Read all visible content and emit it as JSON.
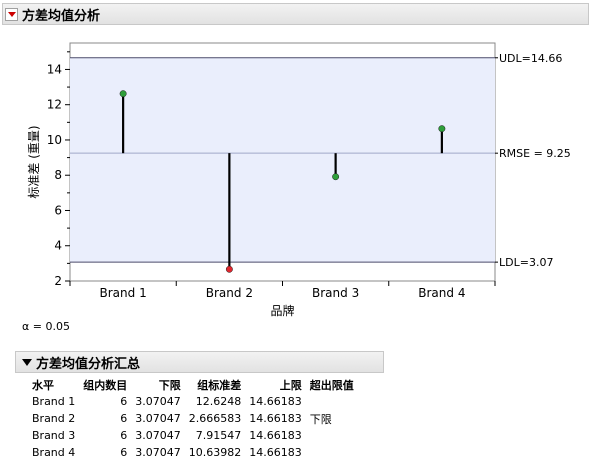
{
  "report": {
    "title": "方差均值分析",
    "alpha_label": "α = 0.05"
  },
  "chart_data": {
    "type": "scatter",
    "xlabel": "品牌",
    "ylabel": "标准差 (重量)",
    "categories": [
      "Brand 1",
      "Brand 2",
      "Brand 3",
      "Brand 4"
    ],
    "values": [
      12.6248,
      2.666583,
      7.91547,
      10.63982
    ],
    "center_line": 9.25,
    "udl": 14.66183,
    "ldl": 3.07047,
    "ylim": [
      2,
      15.5
    ],
    "yticks": [
      2,
      4,
      6,
      8,
      10,
      12,
      14
    ],
    "labels": {
      "udl": "UDL=14.66",
      "center": "RMSE = 9.25",
      "ldl": "LDL=3.07"
    },
    "colors": {
      "plot_bg": "#eaeefc",
      "limit_line": "#4a4a6a",
      "center_line": "#a0a8c8",
      "green": "#2e9e3a",
      "red": "#e0262e"
    }
  },
  "summary": {
    "title": "方差均值分析汇总",
    "columns": [
      "水平",
      "组内数目",
      "下限",
      "组标准差",
      "上限",
      "超出限值"
    ],
    "rows": [
      [
        "Brand 1",
        "6",
        "3.07047",
        "12.6248",
        "14.66183",
        ""
      ],
      [
        "Brand 2",
        "6",
        "3.07047",
        "2.666583",
        "14.66183",
        "下限"
      ],
      [
        "Brand 3",
        "6",
        "3.07047",
        "7.91547",
        "14.66183",
        ""
      ],
      [
        "Brand 4",
        "6",
        "3.07047",
        "10.63982",
        "14.66183",
        ""
      ]
    ]
  }
}
